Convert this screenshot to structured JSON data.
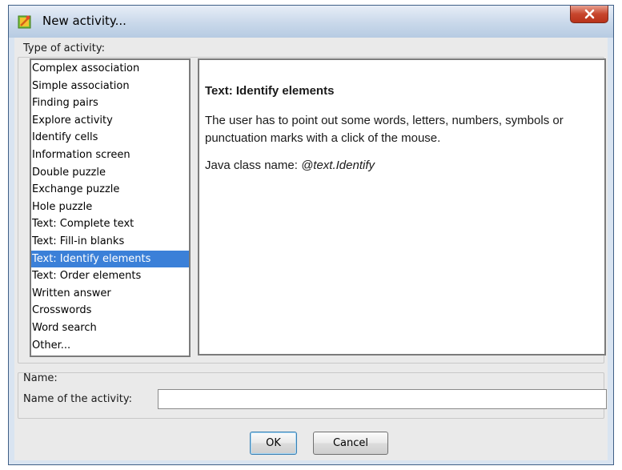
{
  "window": {
    "title": "New activity..."
  },
  "type_section": {
    "label": "Type of activity:",
    "items": [
      "Complex association",
      "Simple association",
      "Finding pairs",
      "Explore activity",
      "Identify cells",
      "Information screen",
      "Double puzzle",
      "Exchange puzzle",
      "Hole puzzle",
      "Text: Complete text",
      "Text: Fill-in blanks",
      "Text: Identify elements",
      "Text: Order elements",
      "Written answer",
      "Crosswords",
      "Word search",
      "Other..."
    ],
    "selected_index": 11
  },
  "description": {
    "title": "Text: Identify elements",
    "text": "The user has to point out some words, letters, numbers, symbols or punctuation marks with a click of the mouse.",
    "java_label": "Java class name: ",
    "java_class": "@text.Identify"
  },
  "name_section": {
    "label": "Name:",
    "field_label": "Name of the activity:",
    "value": "",
    "placeholder": ""
  },
  "buttons": {
    "ok": "OK",
    "cancel": "Cancel"
  },
  "icons": {
    "title": "activity-app-icon",
    "close": "close-icon"
  },
  "colors": {
    "selection": "#3b80d8",
    "close_button": "#c7462d",
    "window_frame": "#d9e4f1"
  }
}
